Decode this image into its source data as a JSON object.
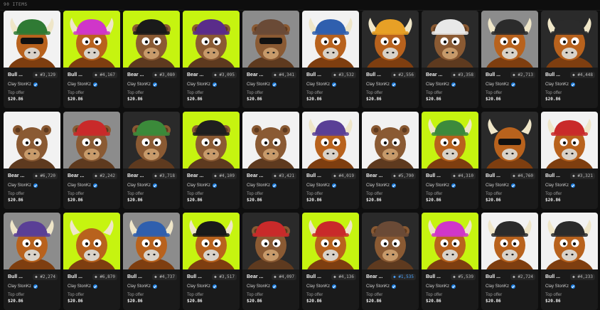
{
  "header": {
    "item_count": "90 ITEMS"
  },
  "creator_label": "Clay StonKz",
  "offer_label": "Top offer",
  "offer_value": "$20.86",
  "colors": {
    "lime": "#c6f410",
    "dark": "#2c2c2c",
    "white_bg": "#f4f4f4",
    "verified": "#2081e2"
  },
  "items": [
    {
      "name": "Bull ...",
      "rank": "◆ #3,129",
      "bg": "white",
      "hat": "#2f7a34",
      "body": "bull",
      "accessory": "shades"
    },
    {
      "name": "Bull ...",
      "rank": "◆ #4,167",
      "bg": "lime",
      "hat": "#d036c9",
      "body": "bull",
      "accessory": "none"
    },
    {
      "name": "Bear ...",
      "rank": "◆ #3,080",
      "bg": "lime",
      "hat": "#1a1a1a",
      "body": "bear",
      "accessory": "none"
    },
    {
      "name": "Bear ...",
      "rank": "◆ #3,095",
      "bg": "lime",
      "hat": "#5a2c8a",
      "body": "bear",
      "accessory": "none"
    },
    {
      "name": "Bear ...",
      "rank": "◆ #4,341",
      "bg": "gray",
      "hat": "#6a4a36",
      "body": "bear",
      "accessory": "shades"
    },
    {
      "name": "Bull ...",
      "rank": "◆ #3,532",
      "bg": "white",
      "hat": "#2f5fae",
      "body": "bull",
      "accessory": "none"
    },
    {
      "name": "Bull ...",
      "rank": "◆ #2,556",
      "bg": "dark",
      "hat": "#e7a026",
      "body": "bull",
      "accessory": "none"
    },
    {
      "name": "Bear ...",
      "rank": "◆ #3,358",
      "bg": "dark",
      "hat": "#e8e8e8",
      "body": "bear",
      "accessory": "none"
    },
    {
      "name": "Bull ...",
      "rank": "◆ #2,713",
      "bg": "gray",
      "hat": "#2b2b2b",
      "body": "bull",
      "accessory": "none"
    },
    {
      "name": "Bull ...",
      "rank": "◆ #4,448",
      "bg": "dark",
      "hat": "#2b2b2b",
      "body": "bull",
      "accessory": "none"
    },
    {
      "name": "Bear ...",
      "rank": "◆ #6,720",
      "bg": "white",
      "hat": "none",
      "body": "bear",
      "accessory": "none"
    },
    {
      "name": "Bear ...",
      "rank": "◆ #2,242",
      "bg": "gray",
      "hat": "#c92a2a",
      "body": "bear",
      "accessory": "none"
    },
    {
      "name": "Bear ...",
      "rank": "◆ #3,718",
      "bg": "dark",
      "hat": "#3b8a3a",
      "body": "bear",
      "accessory": "none"
    },
    {
      "name": "Bear ...",
      "rank": "◆ #4,109",
      "bg": "lime",
      "hat": "#1f1f1f",
      "body": "bear",
      "accessory": "none"
    },
    {
      "name": "Bear ...",
      "rank": "◆ #3,421",
      "bg": "white",
      "hat": "none",
      "body": "bear",
      "accessory": "none"
    },
    {
      "name": "Bull ...",
      "rank": "◆ #4,019",
      "bg": "white",
      "hat": "#5a3f96",
      "body": "bull",
      "accessory": "none"
    },
    {
      "name": "Bear ...",
      "rank": "◆ #5,790",
      "bg": "white",
      "hat": "none",
      "body": "bear",
      "accessory": "none"
    },
    {
      "name": "Bull ...",
      "rank": "◆ #4,310",
      "bg": "lime",
      "hat": "#3c8a3c",
      "body": "bull",
      "accessory": "none"
    },
    {
      "name": "Bull ...",
      "rank": "◆ #4,760",
      "bg": "dark",
      "hat": "none",
      "body": "bull",
      "accessory": "shades"
    },
    {
      "name": "Bull ...",
      "rank": "◆ #3,321",
      "bg": "white",
      "hat": "#c92a2a",
      "body": "bull",
      "accessory": "none"
    },
    {
      "name": "Bull ...",
      "rank": "◆ #2,274",
      "bg": "gray",
      "hat": "#5a3f96",
      "body": "bull",
      "accessory": "none"
    },
    {
      "name": "Bull ...",
      "rank": "◆ #6,870",
      "bg": "lime",
      "hat": "none",
      "body": "bull",
      "accessory": "none"
    },
    {
      "name": "Bull ...",
      "rank": "◆ #4,737",
      "bg": "gray",
      "hat": "#2f5fae",
      "body": "bull",
      "accessory": "none"
    },
    {
      "name": "Bull ...",
      "rank": "◆ #3,517",
      "bg": "lime",
      "hat": "#1a1a1a",
      "body": "bull",
      "accessory": "none"
    },
    {
      "name": "Bear ...",
      "rank": "◆ #4,097",
      "bg": "dark",
      "hat": "#c92a2a",
      "body": "bear",
      "accessory": "none"
    },
    {
      "name": "Bull ...",
      "rank": "◆ #4,136",
      "bg": "lime",
      "hat": "#c92a2a",
      "body": "bull",
      "accessory": "none"
    },
    {
      "name": "Bear ...",
      "rank": "◆ #1,535",
      "bg": "dark",
      "hat": "#6a4a36",
      "body": "bear",
      "accessory": "none",
      "rank_blue": true
    },
    {
      "name": "Bull ...",
      "rank": "◆ #5,539",
      "bg": "lime",
      "hat": "#d036c9",
      "body": "bull",
      "accessory": "none"
    },
    {
      "name": "Bull ...",
      "rank": "◆ #2,724",
      "bg": "white",
      "hat": "#2b2b2b",
      "body": "bull",
      "accessory": "none"
    },
    {
      "name": "Bull ...",
      "rank": "◆ #4,233",
      "bg": "white",
      "hat": "#2b2b2b",
      "body": "bull",
      "accessory": "none"
    }
  ]
}
